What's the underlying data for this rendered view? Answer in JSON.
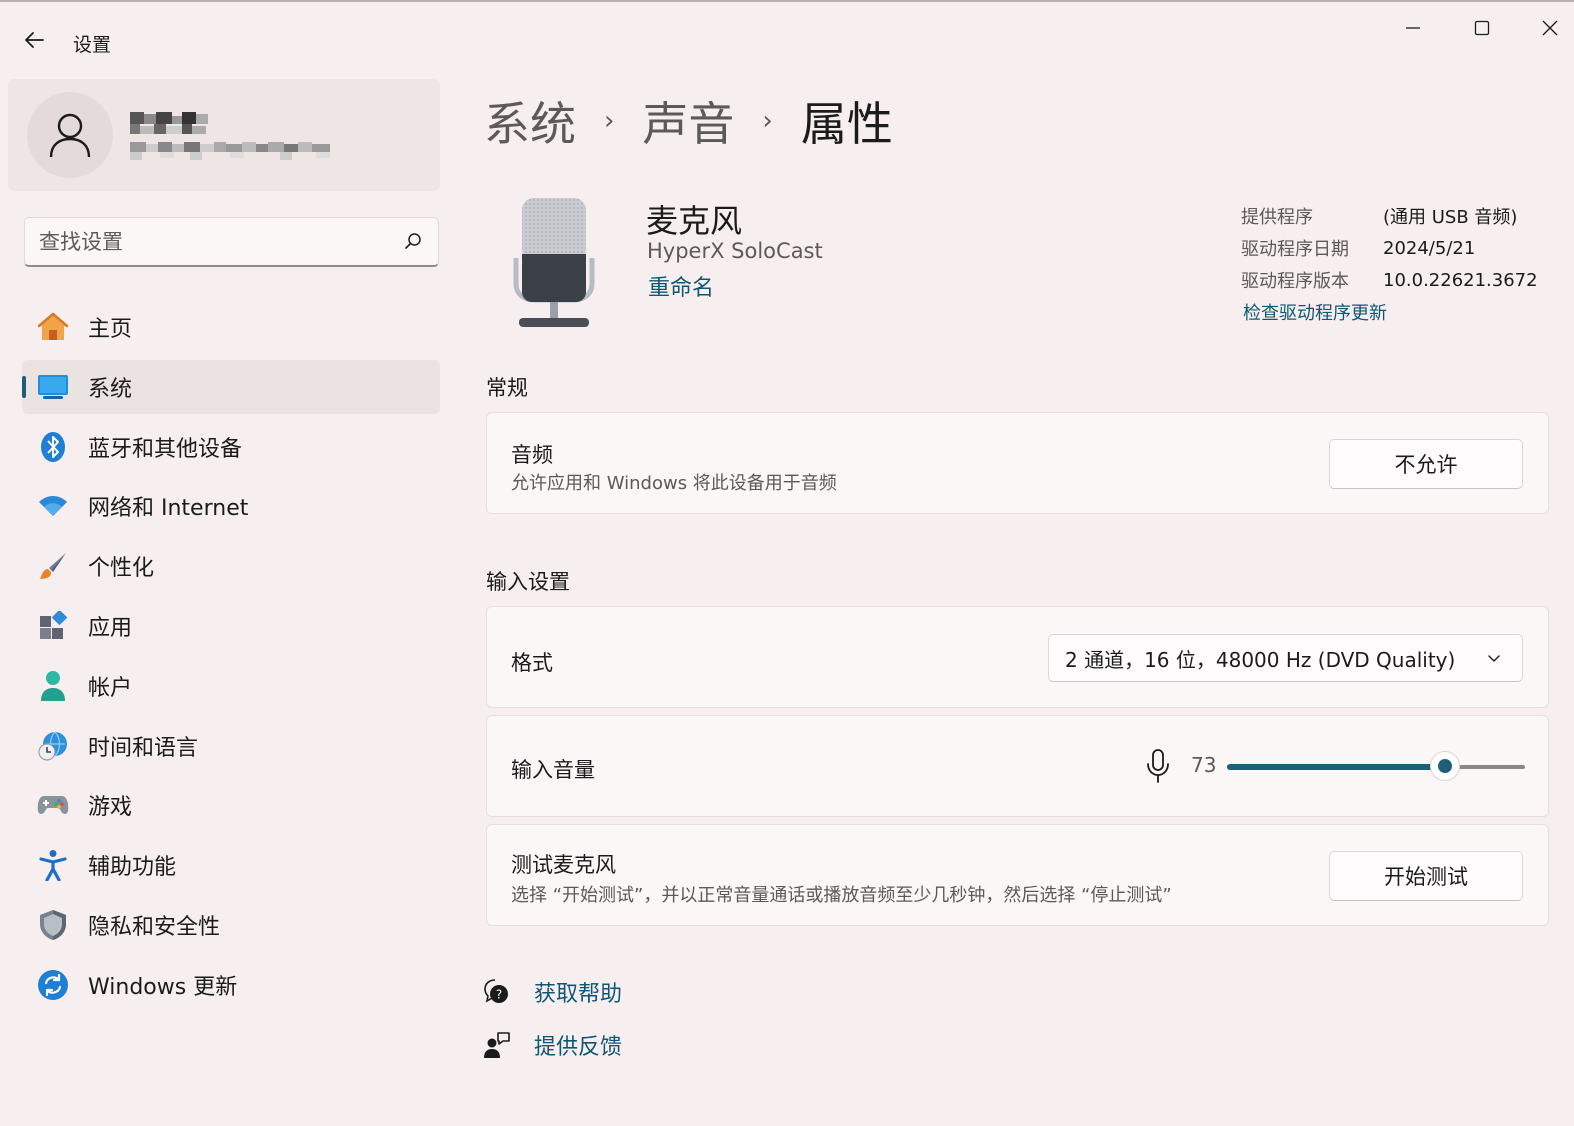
{
  "window": {
    "title": "设置",
    "controls": {
      "minimize": "minimize-icon",
      "maximize": "maximize-icon",
      "close": "close-icon"
    }
  },
  "search": {
    "placeholder": "查找设置"
  },
  "sidebar": {
    "items": [
      {
        "label": "主页",
        "icon": "home-icon",
        "active": false
      },
      {
        "label": "系统",
        "icon": "system-icon",
        "active": true
      },
      {
        "label": "蓝牙和其他设备",
        "icon": "bluetooth-icon",
        "active": false
      },
      {
        "label": "网络和 Internet",
        "icon": "wifi-icon",
        "active": false
      },
      {
        "label": "个性化",
        "icon": "brush-icon",
        "active": false
      },
      {
        "label": "应用",
        "icon": "apps-icon",
        "active": false
      },
      {
        "label": "帐户",
        "icon": "account-icon",
        "active": false
      },
      {
        "label": "时间和语言",
        "icon": "time-language-icon",
        "active": false
      },
      {
        "label": "游戏",
        "icon": "gaming-icon",
        "active": false
      },
      {
        "label": "辅助功能",
        "icon": "accessibility-icon",
        "active": false
      },
      {
        "label": "隐私和安全性",
        "icon": "shield-icon",
        "active": false
      },
      {
        "label": "Windows 更新",
        "icon": "update-icon",
        "active": false
      }
    ]
  },
  "breadcrumb": {
    "items": [
      "系统",
      "声音",
      "属性"
    ],
    "separator": "›"
  },
  "device": {
    "name": "麦克风",
    "model": "HyperX SoloCast",
    "rename_label": "重命名"
  },
  "driver": {
    "rows": [
      {
        "key": "提供程序",
        "value": "(通用 USB 音频)"
      },
      {
        "key": "驱动程序日期",
        "value": "2024/5/21"
      },
      {
        "key": "驱动程序版本",
        "value": "10.0.22621.3672"
      }
    ],
    "update_link": "检查驱动程序更新"
  },
  "general": {
    "section_title": "常规",
    "audio": {
      "title": "音频",
      "description": "允许应用和 Windows 将此设备用于音频",
      "button": "不允许"
    }
  },
  "input_settings": {
    "section_title": "输入设置",
    "format": {
      "title": "格式",
      "selected": "2 通道，16 位，48000 Hz (DVD Quality)"
    },
    "volume": {
      "title": "输入音量",
      "value": "73",
      "level": 73
    },
    "test": {
      "title": "测试麦克风",
      "description": "选择 “开始测试”，并以正常音量通话或播放音频至少几秒钟，然后选择 “停止测试”",
      "button": "开始测试"
    }
  },
  "footer_links": {
    "help": "获取帮助",
    "feedback": "提供反馈"
  },
  "colors": {
    "accent": "#1f5e78",
    "link": "#0f5674",
    "background": "#f7efef",
    "card": "#fbf7f7"
  }
}
